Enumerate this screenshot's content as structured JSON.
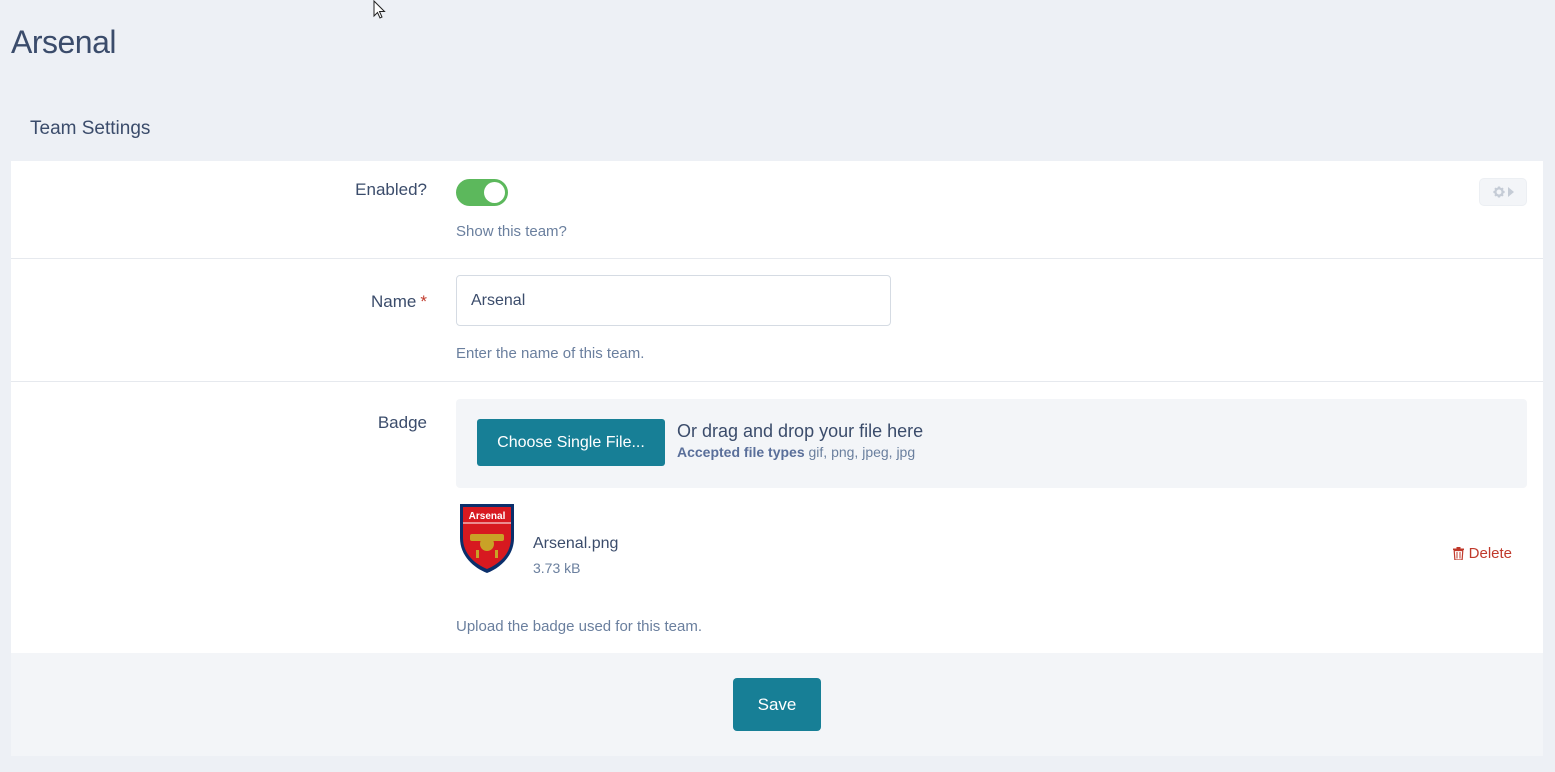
{
  "page": {
    "title": "Arsenal",
    "section_title": "Team Settings"
  },
  "enabled_field": {
    "label": "Enabled?",
    "value": true,
    "help": "Show this team?",
    "settings_icon": "gear-icon"
  },
  "name_field": {
    "label": "Name",
    "required_marker": "*",
    "value": "Arsenal",
    "help": "Enter the name of this team."
  },
  "badge_field": {
    "label": "Badge",
    "choose_button": "Choose Single File...",
    "drop_text": "Or drag and drop your file here",
    "accepted_label": "Accepted file types",
    "accepted_types": "gif, png, jpeg, jpg",
    "file": {
      "name": "Arsenal.png",
      "size": "3.73 kB",
      "thumb_text": "Arsenal"
    },
    "delete_label": "Delete",
    "help": "Upload the badge used for this team."
  },
  "footer": {
    "save_label": "Save"
  },
  "colors": {
    "accent": "#177f96",
    "toggle_on": "#5cb85c",
    "danger": "#c0392b",
    "background": "#edf0f5"
  }
}
